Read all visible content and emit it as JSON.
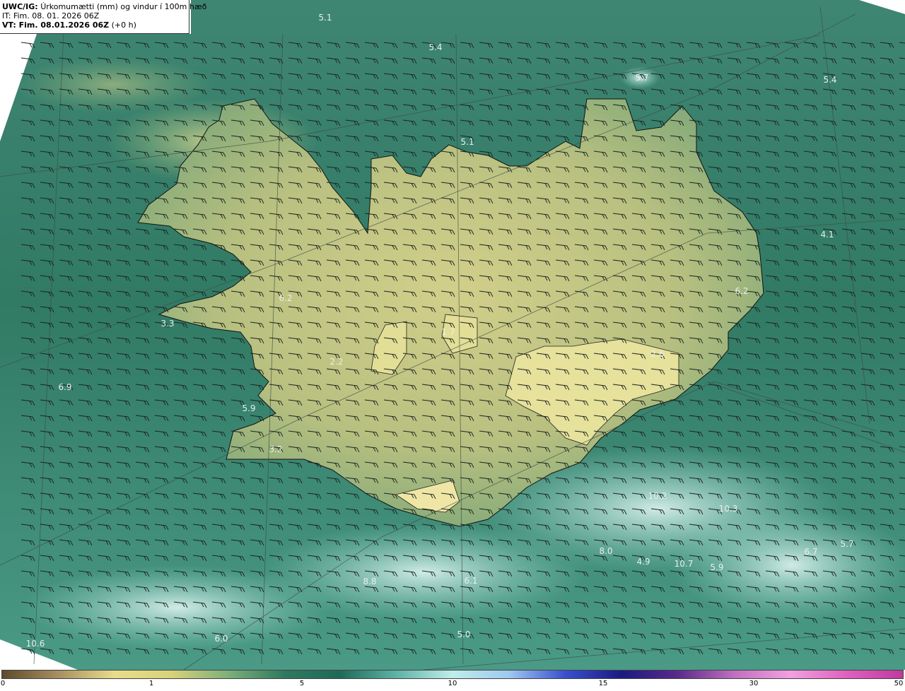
{
  "header": {
    "code": "UWC/IG:",
    "title": "Úrkomumætti (mm) og vindur í 100m hæð",
    "it_line": "IT: Fim. 08. 01. 2026 06Z",
    "vt_prefix": "VT: Fim. 08.01.2026 06Z",
    "vt_suffix": "(+0 h)"
  },
  "value_labels": [
    {
      "id": "v1",
      "text": "5.1"
    },
    {
      "id": "v2",
      "text": "5.4"
    },
    {
      "id": "v3",
      "text": "5.7"
    },
    {
      "id": "v4",
      "text": "5.4"
    },
    {
      "id": "v5",
      "text": "5.1"
    },
    {
      "id": "v6",
      "text": "4.1"
    },
    {
      "id": "v7",
      "text": "6.2"
    },
    {
      "id": "v8",
      "text": "6.2"
    },
    {
      "id": "v9",
      "text": "3.3"
    },
    {
      "id": "v10",
      "text": "1.7"
    },
    {
      "id": "v11",
      "text": "2.2"
    },
    {
      "id": "v12",
      "text": "2.6"
    },
    {
      "id": "v13",
      "text": "6.9"
    },
    {
      "id": "v14",
      "text": "5.9"
    },
    {
      "id": "v15",
      "text": "3.2"
    },
    {
      "id": "v16",
      "text": "10.2"
    },
    {
      "id": "v17",
      "text": "10.3"
    },
    {
      "id": "v18",
      "text": "5.7"
    },
    {
      "id": "v19",
      "text": "6.7"
    },
    {
      "id": "v20",
      "text": "8.0"
    },
    {
      "id": "v21",
      "text": "4.9"
    },
    {
      "id": "v22",
      "text": "10.7"
    },
    {
      "id": "v23",
      "text": "5.9"
    },
    {
      "id": "v24",
      "text": "8.8"
    },
    {
      "id": "v25",
      "text": "6.1"
    },
    {
      "id": "v26",
      "text": "6.0"
    },
    {
      "id": "v27",
      "text": "5.0"
    },
    {
      "id": "v28",
      "text": "10.6"
    }
  ],
  "colorbar": {
    "ticks": [
      "0",
      "1",
      "5",
      "10",
      "15",
      "30",
      "50"
    ],
    "tick_values": [
      0,
      1,
      5,
      10,
      15,
      30,
      50
    ],
    "colors": [
      "#5e4a2c",
      "#a89060",
      "#e8dc8c",
      "#d8d27a",
      "#7fb07a",
      "#2f7a5e",
      "#1e6a58",
      "#5fb3a6",
      "#bfeeea",
      "#9fc8f0",
      "#3a4fd0",
      "#1a1a80",
      "#5a2a8a",
      "#c070c0",
      "#f0a0e0",
      "#e060c0",
      "#c03aa0"
    ]
  },
  "palette": {
    "sea": "#2f7a66",
    "land": "#c9c985",
    "coast": "#111111",
    "grid": "#3a4a44"
  }
}
